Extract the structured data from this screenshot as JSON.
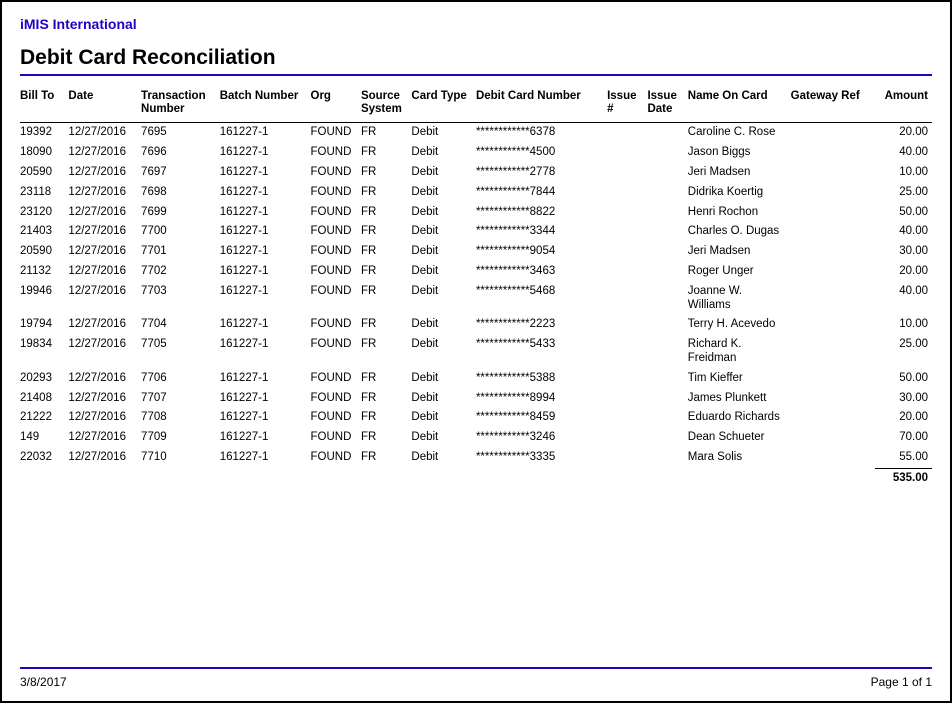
{
  "header": {
    "org_name": "iMIS International",
    "report_title": "Debit Card Reconciliation"
  },
  "columns": {
    "bill_to": "Bill To",
    "date": "Date",
    "txn_number": "Transaction Number",
    "batch_number": "Batch Number",
    "org": "Org",
    "source_system": "Source System",
    "card_type": "Card Type",
    "debit_card_number": "Debit Card Number",
    "issue_num": "Issue #",
    "issue_date": "Issue Date",
    "name_on_card": "Name On Card",
    "gateway_ref": "Gateway Ref",
    "amount": "Amount"
  },
  "rows": [
    {
      "bill_to": "19392",
      "date": "12/27/2016",
      "txn": "7695",
      "batch": "161227-1",
      "org": "FOUND",
      "src": "FR",
      "ctype": "Debit",
      "cnum": "************6378",
      "issnum": "",
      "issdate": "",
      "name": "Caroline C. Rose",
      "gwref": "",
      "amount": "20.00"
    },
    {
      "bill_to": "18090",
      "date": "12/27/2016",
      "txn": "7696",
      "batch": "161227-1",
      "org": "FOUND",
      "src": "FR",
      "ctype": "Debit",
      "cnum": "************4500",
      "issnum": "",
      "issdate": "",
      "name": "Jason Biggs",
      "gwref": "",
      "amount": "40.00"
    },
    {
      "bill_to": "20590",
      "date": "12/27/2016",
      "txn": "7697",
      "batch": "161227-1",
      "org": "FOUND",
      "src": "FR",
      "ctype": "Debit",
      "cnum": "************2778",
      "issnum": "",
      "issdate": "",
      "name": "Jeri Madsen",
      "gwref": "",
      "amount": "10.00"
    },
    {
      "bill_to": "23118",
      "date": "12/27/2016",
      "txn": "7698",
      "batch": "161227-1",
      "org": "FOUND",
      "src": "FR",
      "ctype": "Debit",
      "cnum": "************7844",
      "issnum": "",
      "issdate": "",
      "name": "Didrika Koertig",
      "gwref": "",
      "amount": "25.00"
    },
    {
      "bill_to": "23120",
      "date": "12/27/2016",
      "txn": "7699",
      "batch": "161227-1",
      "org": "FOUND",
      "src": "FR",
      "ctype": "Debit",
      "cnum": "************8822",
      "issnum": "",
      "issdate": "",
      "name": "Henri Rochon",
      "gwref": "",
      "amount": "50.00"
    },
    {
      "bill_to": "21403",
      "date": "12/27/2016",
      "txn": "7700",
      "batch": "161227-1",
      "org": "FOUND",
      "src": "FR",
      "ctype": "Debit",
      "cnum": "************3344",
      "issnum": "",
      "issdate": "",
      "name": "Charles O. Dugas",
      "gwref": "",
      "amount": "40.00"
    },
    {
      "bill_to": "20590",
      "date": "12/27/2016",
      "txn": "7701",
      "batch": "161227-1",
      "org": "FOUND",
      "src": "FR",
      "ctype": "Debit",
      "cnum": "************9054",
      "issnum": "",
      "issdate": "",
      "name": "Jeri Madsen",
      "gwref": "",
      "amount": "30.00"
    },
    {
      "bill_to": "21132",
      "date": "12/27/2016",
      "txn": "7702",
      "batch": "161227-1",
      "org": "FOUND",
      "src": "FR",
      "ctype": "Debit",
      "cnum": "************3463",
      "issnum": "",
      "issdate": "",
      "name": "Roger Unger",
      "gwref": "",
      "amount": "20.00"
    },
    {
      "bill_to": "19946",
      "date": "12/27/2016",
      "txn": "7703",
      "batch": "161227-1",
      "org": "FOUND",
      "src": "FR",
      "ctype": "Debit",
      "cnum": "************5468",
      "issnum": "",
      "issdate": "",
      "name": "Joanne W. Williams",
      "gwref": "",
      "amount": "40.00"
    },
    {
      "bill_to": "19794",
      "date": "12/27/2016",
      "txn": "7704",
      "batch": "161227-1",
      "org": "FOUND",
      "src": "FR",
      "ctype": "Debit",
      "cnum": "************2223",
      "issnum": "",
      "issdate": "",
      "name": "Terry H. Acevedo",
      "gwref": "",
      "amount": "10.00"
    },
    {
      "bill_to": "19834",
      "date": "12/27/2016",
      "txn": "7705",
      "batch": "161227-1",
      "org": "FOUND",
      "src": "FR",
      "ctype": "Debit",
      "cnum": "************5433",
      "issnum": "",
      "issdate": "",
      "name": "Richard K. Freidman",
      "gwref": "",
      "amount": "25.00"
    },
    {
      "bill_to": "20293",
      "date": "12/27/2016",
      "txn": "7706",
      "batch": "161227-1",
      "org": "FOUND",
      "src": "FR",
      "ctype": "Debit",
      "cnum": "************5388",
      "issnum": "",
      "issdate": "",
      "name": "Tim Kieffer",
      "gwref": "",
      "amount": "50.00"
    },
    {
      "bill_to": "21408",
      "date": "12/27/2016",
      "txn": "7707",
      "batch": "161227-1",
      "org": "FOUND",
      "src": "FR",
      "ctype": "Debit",
      "cnum": "************8994",
      "issnum": "",
      "issdate": "",
      "name": "James Plunkett",
      "gwref": "",
      "amount": "30.00"
    },
    {
      "bill_to": "21222",
      "date": "12/27/2016",
      "txn": "7708",
      "batch": "161227-1",
      "org": "FOUND",
      "src": "FR",
      "ctype": "Debit",
      "cnum": "************8459",
      "issnum": "",
      "issdate": "",
      "name": "Eduardo Richards",
      "gwref": "",
      "amount": "20.00"
    },
    {
      "bill_to": "149",
      "date": "12/27/2016",
      "txn": "7709",
      "batch": "161227-1",
      "org": "FOUND",
      "src": "FR",
      "ctype": "Debit",
      "cnum": "************3246",
      "issnum": "",
      "issdate": "",
      "name": "Dean Schueter",
      "gwref": "",
      "amount": "70.00"
    },
    {
      "bill_to": "22032",
      "date": "12/27/2016",
      "txn": "7710",
      "batch": "161227-1",
      "org": "FOUND",
      "src": "FR",
      "ctype": "Debit",
      "cnum": "************3335",
      "issnum": "",
      "issdate": "",
      "name": "Mara Solis",
      "gwref": "",
      "amount": "55.00"
    }
  ],
  "total": "535.00",
  "footer": {
    "date": "3/8/2017",
    "page_label": "Page 1 of  1"
  }
}
